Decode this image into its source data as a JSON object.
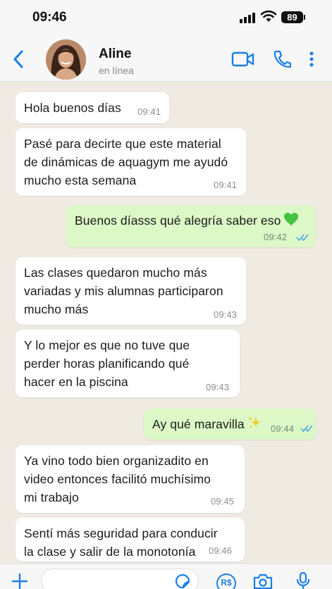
{
  "status_bar": {
    "time": "09:46",
    "battery": "89"
  },
  "header": {
    "contact_name": "Aline",
    "contact_status": "en línea"
  },
  "messages": [
    {
      "lines": [
        "Hola buenos días"
      ],
      "time": "09:41"
    },
    {
      "lines": [
        "Pasé para decirte que este material",
        "de dinámicas de aquagym me ayudó",
        "mucho esta semana"
      ],
      "time": "09:41"
    },
    {
      "lines": [
        "Buenos díasss qué alegría saber eso"
      ],
      "time": "09:42"
    },
    {
      "lines": [
        "Las clases quedaron mucho más",
        "variadas y mis alumnas participaron",
        "mucho más"
      ],
      "time": "09:43"
    },
    {
      "lines": [
        "Y lo mejor es que no tuve que",
        "perder horas planificando qué",
        "hacer en la piscina"
      ],
      "time": "09:43"
    },
    {
      "lines": [
        "Ay qué maravilla"
      ],
      "time": "09:44"
    },
    {
      "lines": [
        "Ya vino todo bien organizadito en",
        "video entonces facilitó muchísimo",
        "mi trabajo"
      ],
      "time": "09:45"
    },
    {
      "lines": [
        "Sentí más seguridad para conducir",
        "la clase y salir de la monotonía"
      ],
      "time": "09:46"
    }
  ],
  "composer": {
    "currency_label": "R$"
  },
  "colors": {
    "accent": "#1a7ee8",
    "outgoing_bubble": "#dcf8c6",
    "incoming_bubble": "#ffffff",
    "chat_background": "#efeae2",
    "read_ticks": "#4fa6e8"
  },
  "icons": [
    "back-chevron-icon",
    "video-call-icon",
    "phone-call-icon",
    "more-options-icon",
    "plus-icon",
    "sticker-icon",
    "pix-payment-icon",
    "camera-icon",
    "microphone-icon",
    "double-check-icon",
    "green-heart-emoji",
    "sparkles-emoji"
  ]
}
